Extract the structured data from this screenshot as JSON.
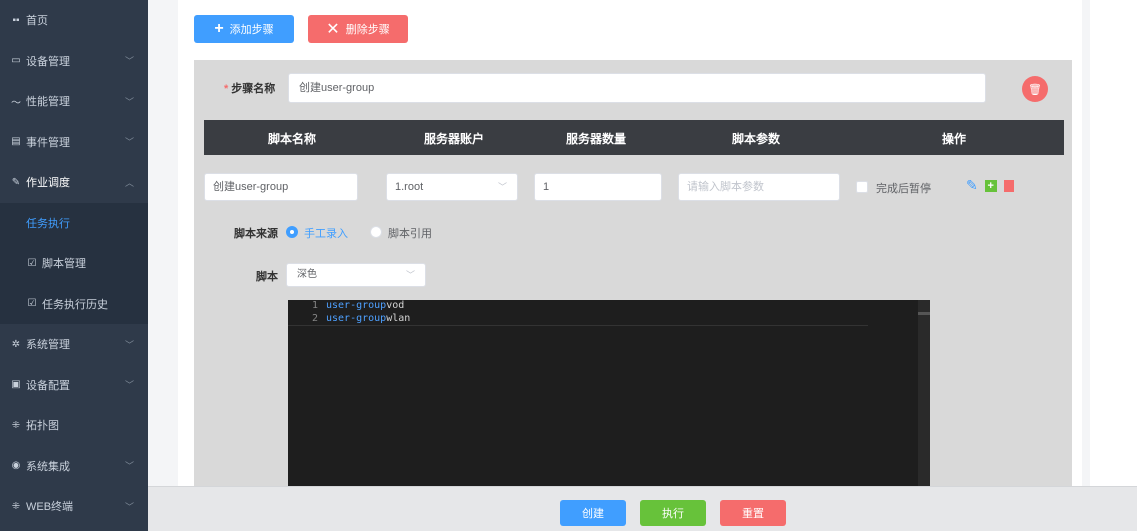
{
  "sidebar": {
    "items": [
      {
        "label": "首页",
        "icon": "grid-icon",
        "glyph": "▪▪",
        "chevron": false
      },
      {
        "label": "设备管理",
        "icon": "device-icon",
        "glyph": "▭",
        "chevron": true
      },
      {
        "label": "性能管理",
        "icon": "trend-icon",
        "glyph": "〜",
        "chevron": true
      },
      {
        "label": "事件管理",
        "icon": "event-icon",
        "glyph": "▤",
        "chevron": true
      },
      {
        "label": "作业调度",
        "icon": "pencil-icon",
        "glyph": "✎",
        "chevron": true,
        "expanded": true
      },
      {
        "label": "任务执行",
        "sub": true,
        "active": true
      },
      {
        "label": "脚本管理",
        "sub": true,
        "icon": "edit-icon",
        "glyph": "☑"
      },
      {
        "label": "任务执行历史",
        "sub": true,
        "icon": "edit-icon",
        "glyph": "☑"
      },
      {
        "label": "系统管理",
        "icon": "gear-icon",
        "glyph": "✲",
        "chevron": true
      },
      {
        "label": "设备配置",
        "icon": "config-icon",
        "glyph": "▣",
        "chevron": true
      },
      {
        "label": "拓扑图",
        "icon": "topology-icon",
        "glyph": "⁜",
        "chevron": false
      },
      {
        "label": "系统集成",
        "icon": "location-icon",
        "glyph": "◉",
        "chevron": true
      },
      {
        "label": "WEB终端",
        "icon": "terminal-icon",
        "glyph": "⁜",
        "chevron": true
      }
    ]
  },
  "toolbar": {
    "add_step": "添加步骤",
    "delete_step": "删除步骤"
  },
  "step": {
    "name_label": "步骤名称",
    "name_value": "创建user-group",
    "table_headers": [
      "脚本名称",
      "服务器账户",
      "服务器数量",
      "脚本参数",
      "操作"
    ],
    "row": {
      "script_name": "创建user-group",
      "account": "1.root",
      "count": "1",
      "params_placeholder": "请输入脚本参数",
      "pause_label": "完成后暂停"
    },
    "source_label": "脚本来源",
    "source_options": [
      "手工录入",
      "脚本引用"
    ],
    "script_label": "脚本",
    "theme_value": "深色",
    "code_lines": [
      {
        "num": "1",
        "kw": "user-group",
        "rest": " vod"
      },
      {
        "num": "2",
        "kw": "user-group",
        "rest": " wlan"
      }
    ]
  },
  "footer": {
    "create": "创建",
    "run": "执行",
    "reset": "重置"
  },
  "colors": {
    "primary": "#409eff",
    "danger": "#f56c6c",
    "success": "#67c23a",
    "sidebar": "#2f3a4a"
  }
}
